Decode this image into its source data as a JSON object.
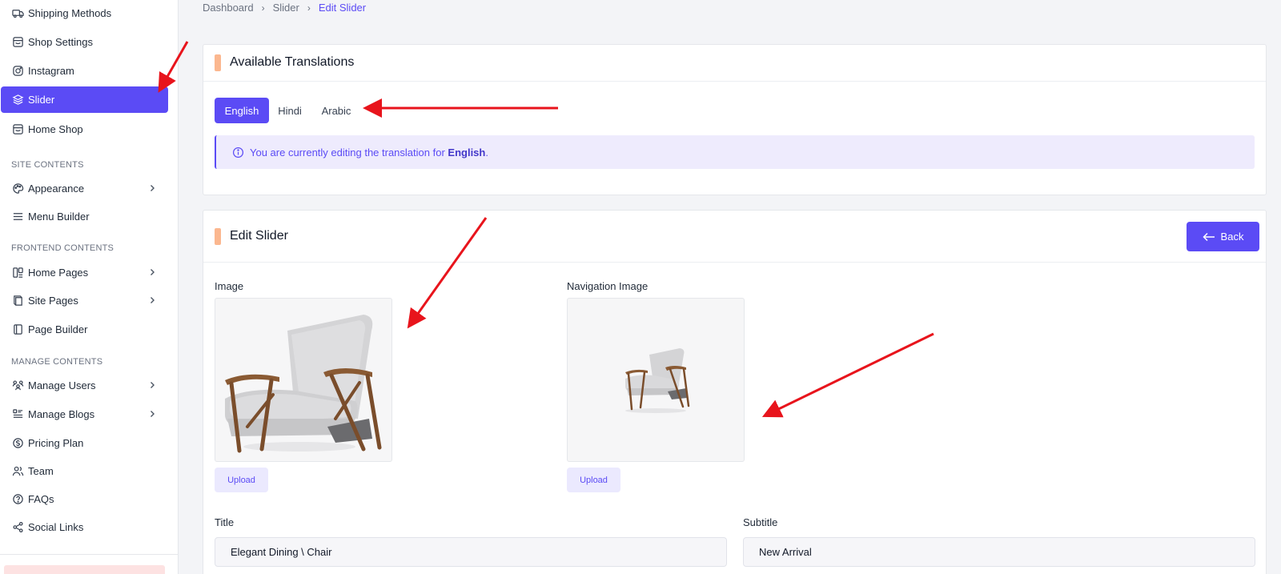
{
  "sidebar": {
    "items": [
      {
        "label": "Shipping Methods",
        "icon": "truck-icon"
      },
      {
        "label": "Shop Settings",
        "icon": "store-icon"
      },
      {
        "label": "Instagram",
        "icon": "instagram-icon"
      },
      {
        "label": "Slider",
        "icon": "layers-icon",
        "active": true
      },
      {
        "label": "Home Shop",
        "icon": "store-icon"
      }
    ],
    "sections": [
      {
        "title": "SITE CONTENTS",
        "items": [
          {
            "label": "Appearance",
            "icon": "palette-icon",
            "has_submenu": true
          },
          {
            "label": "Menu Builder",
            "icon": "menu-icon",
            "has_submenu": false
          }
        ]
      },
      {
        "title": "FRONTEND CONTENTS",
        "items": [
          {
            "label": "Home Pages",
            "icon": "home-pages-icon",
            "has_submenu": true
          },
          {
            "label": "Site Pages",
            "icon": "book-icon",
            "has_submenu": true
          },
          {
            "label": "Page Builder",
            "icon": "notebook-icon",
            "has_submenu": false
          }
        ]
      },
      {
        "title": "MANAGE CONTENTS",
        "items": [
          {
            "label": "Manage Users",
            "icon": "users-icon",
            "has_submenu": true
          },
          {
            "label": "Manage Blogs",
            "icon": "blog-list-icon",
            "has_submenu": true
          },
          {
            "label": "Pricing Plan",
            "icon": "dollar-circle-icon",
            "has_submenu": false
          },
          {
            "label": "Team",
            "icon": "team-icon",
            "has_submenu": false
          },
          {
            "label": "FAQs",
            "icon": "question-circle-icon",
            "has_submenu": false
          },
          {
            "label": "Social Links",
            "icon": "share-icon",
            "has_submenu": false
          }
        ]
      }
    ]
  },
  "breadcrumb": {
    "items": [
      "Dashboard",
      "Slider",
      "Edit Slider"
    ]
  },
  "translations": {
    "title": "Available Translations",
    "tabs": [
      "English",
      "Hindi",
      "Arabic"
    ],
    "active_tab": "English",
    "info_prefix": "You are currently editing the translation for",
    "info_language": "English",
    "info_suffix": "."
  },
  "edit_slider": {
    "title": "Edit Slider",
    "back_label": "Back",
    "image_label": "Image",
    "navigation_image_label": "Navigation Image",
    "upload_label": "Upload",
    "title_label": "Title",
    "title_value": "Elegant Dining \\ Chair",
    "subtitle_label": "Subtitle",
    "subtitle_value": "New Arrival"
  },
  "colors": {
    "primary": "#5b4bf5",
    "accent": "#fbb78f",
    "annotation_arrow": "#e8141c"
  }
}
